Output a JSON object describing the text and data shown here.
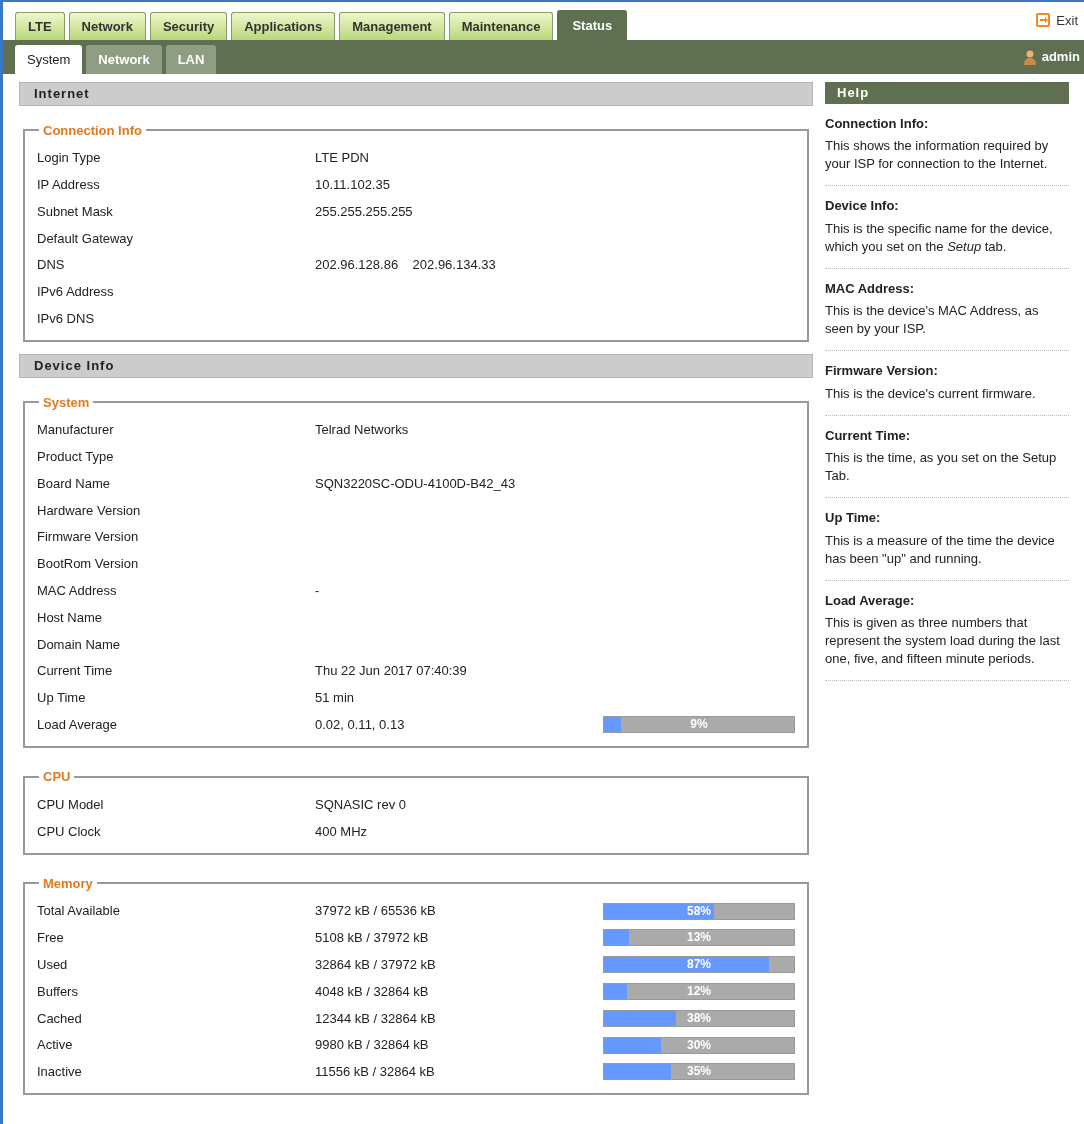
{
  "tabs": [
    {
      "label": "LTE",
      "selected": false
    },
    {
      "label": "Network",
      "selected": false
    },
    {
      "label": "Security",
      "selected": false
    },
    {
      "label": "Applications",
      "selected": false
    },
    {
      "label": "Management",
      "selected": false
    },
    {
      "label": "Maintenance",
      "selected": false
    },
    {
      "label": "Status",
      "selected": true
    }
  ],
  "exit": "Exit",
  "subtabs": [
    {
      "label": "System",
      "selected": true
    },
    {
      "label": "Network",
      "selected": false
    },
    {
      "label": "LAN",
      "selected": false
    }
  ],
  "user": "admin",
  "sections": [
    {
      "title": "Internet",
      "groups": [
        {
          "legend": "Connection Info",
          "rows": [
            {
              "label": "Login Type",
              "value": "LTE PDN"
            },
            {
              "label": "IP Address",
              "value": "10.11.102.35"
            },
            {
              "label": "Subnet Mask",
              "value": "255.255.255.255"
            },
            {
              "label": "Default Gateway"
            },
            {
              "label": "DNS",
              "value": "202.96.128.86    202.96.134.33"
            },
            {
              "label": "IPv6 Address"
            },
            {
              "label": "IPv6 DNS"
            }
          ]
        }
      ]
    },
    {
      "title": "Device Info",
      "groups": [
        {
          "legend": "System",
          "rows": [
            {
              "label": "Manufacturer",
              "value": "Telrad Networks"
            },
            {
              "label": "Product Type"
            },
            {
              "label": "Board Name",
              "value": "SQN3220SC-ODU-4100D-B42_43"
            },
            {
              "label": "Hardware Version"
            },
            {
              "label": "Firmware Version"
            },
            {
              "label": "BootRom Version"
            },
            {
              "label": "MAC Address",
              "value": "-"
            },
            {
              "label": "Host Name"
            },
            {
              "label": "Domain Name"
            },
            {
              "label": "Current Time",
              "value": "Thu 22 Jun 2017 07:40:39"
            },
            {
              "label": "Up Time",
              "value": "51 min"
            },
            {
              "label": "Load Average",
              "value": "0.02, 0.11, 0.13",
              "level": 0.09,
              "reading": "9%"
            }
          ]
        },
        {
          "legend": "CPU",
          "rows": [
            {
              "label": "CPU Model",
              "value": "SQNASIC rev 0"
            },
            {
              "label": "CPU Clock",
              "value": "400 MHz"
            }
          ]
        },
        {
          "legend": "Memory",
          "rows": [
            {
              "label": "Total Available",
              "value": "37972 kB / 65536 kB",
              "level": 0.58,
              "reading": "58%"
            },
            {
              "label": "Free",
              "value": "5108 kB / 37972 kB",
              "level": 0.13,
              "reading": "13%"
            },
            {
              "label": "Used",
              "value": "32864 kB / 37972 kB",
              "level": 0.87,
              "reading": "87%"
            },
            {
              "label": "Buffers",
              "value": "4048 kB / 32864 kB",
              "level": 0.12,
              "reading": "12%"
            },
            {
              "label": "Cached",
              "value": "12344 kB / 32864 kB",
              "level": 0.38,
              "reading": "38%"
            },
            {
              "label": "Active",
              "value": "9980 kB / 32864 kB",
              "level": 0.3,
              "reading": "30%"
            },
            {
              "label": "Inactive",
              "value": "11556 kB / 32864 kB",
              "level": 0.35,
              "reading": "35%"
            }
          ]
        }
      ]
    }
  ],
  "help": {
    "title": "Help",
    "items": [
      {
        "heading": "Connection Info:",
        "text": "This shows the information required by your ISP for connection to the Internet."
      },
      {
        "heading": "Device Info:",
        "text": "This is the specific name for the device, which you set on the *Setup* tab."
      },
      {
        "heading": "MAC Address:",
        "text": "This is the device's MAC Address, as seen by your ISP."
      },
      {
        "heading": "Firmware Version:",
        "text": "This is the device's current firmware."
      },
      {
        "heading": "Current Time:",
        "text": "This is the time, as you set on the Setup Tab."
      },
      {
        "heading": "Up Time:",
        "text": "This is a measure of the time the device has been \"up\" and running."
      },
      {
        "heading": "Load Average:",
        "text": "This is given as three numbers that represent the system load during the last one, five, and fifteen minute periods."
      }
    ]
  }
}
